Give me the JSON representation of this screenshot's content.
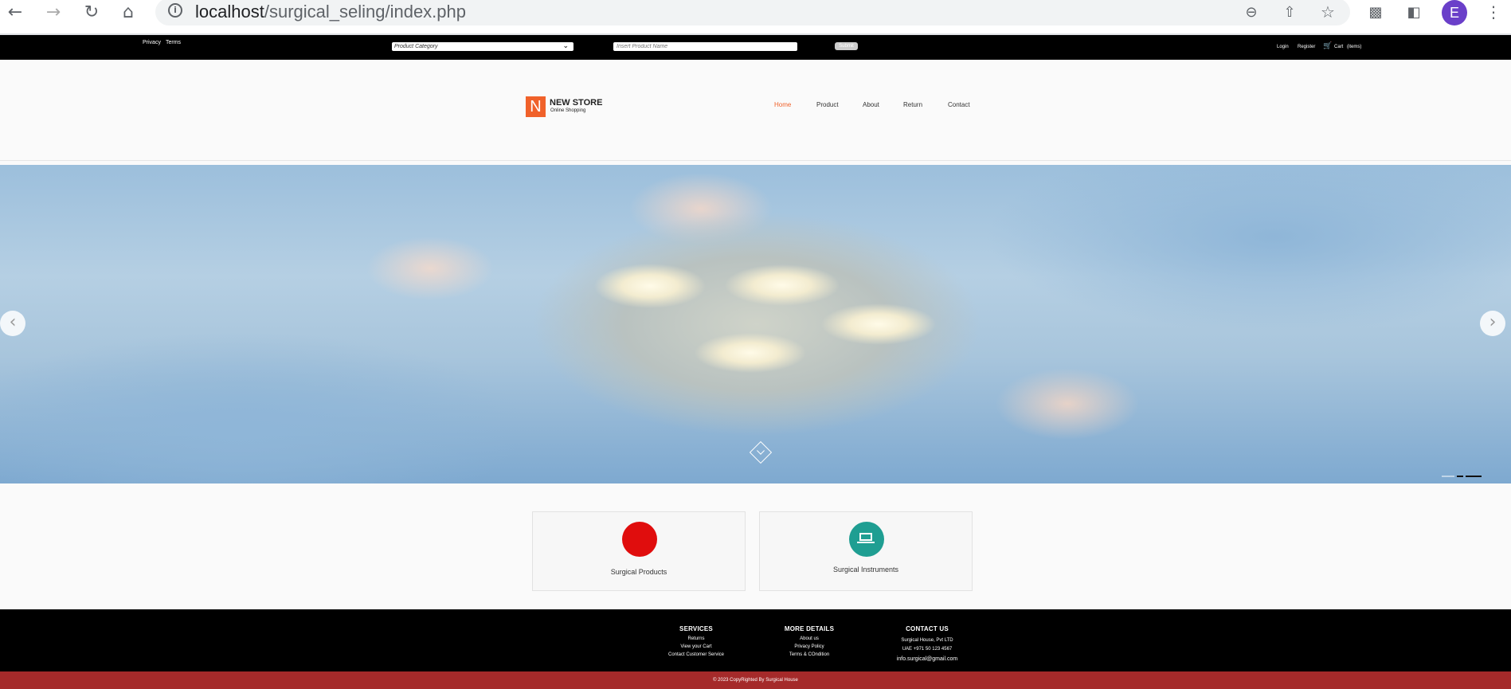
{
  "browser": {
    "url_host": "localhost",
    "url_path": "/surgical_seling/index.php",
    "profile_initial": "E"
  },
  "topbar": {
    "links_left": [
      "Privacy",
      "Terms"
    ],
    "category_placeholder": "Product Category",
    "search_placeholder": "Insert Product Name",
    "submit_label": "Submit",
    "login_label": "Login",
    "register_label": "Register",
    "cart_label": "Cart",
    "cart_items": "(items)"
  },
  "header": {
    "logo_letter": "N",
    "logo_title": "NEW STORE",
    "logo_subtitle": "Online Shopping",
    "nav": [
      "Home",
      "Product",
      "About",
      "Return",
      "Contact"
    ],
    "active_nav": "Home"
  },
  "categories": [
    {
      "label": "Surgical Products",
      "color": "#e00d0d"
    },
    {
      "label": "Surgical Instruments",
      "color": "#1f9e92",
      "icon": "laptop-icon"
    }
  ],
  "footer": {
    "services": {
      "heading": "SERVICES",
      "items": [
        "Returns",
        "View your Cart",
        "Contact Customer Service"
      ]
    },
    "more": {
      "heading": "MORE DETAILS",
      "items": [
        "About us",
        "Privacy Policy",
        "Terms & COndition"
      ]
    },
    "contact": {
      "heading": "CONTACT US",
      "items": [
        "Surgical House, Pvt LTD",
        "UAE +971 50 123 4567",
        "info.surgical@gmail.com"
      ]
    },
    "copyright": "© 2023 CopyRighted By Surgical House"
  },
  "colors": {
    "accent": "#f0612a",
    "copyright_bar": "#a52a2a"
  }
}
